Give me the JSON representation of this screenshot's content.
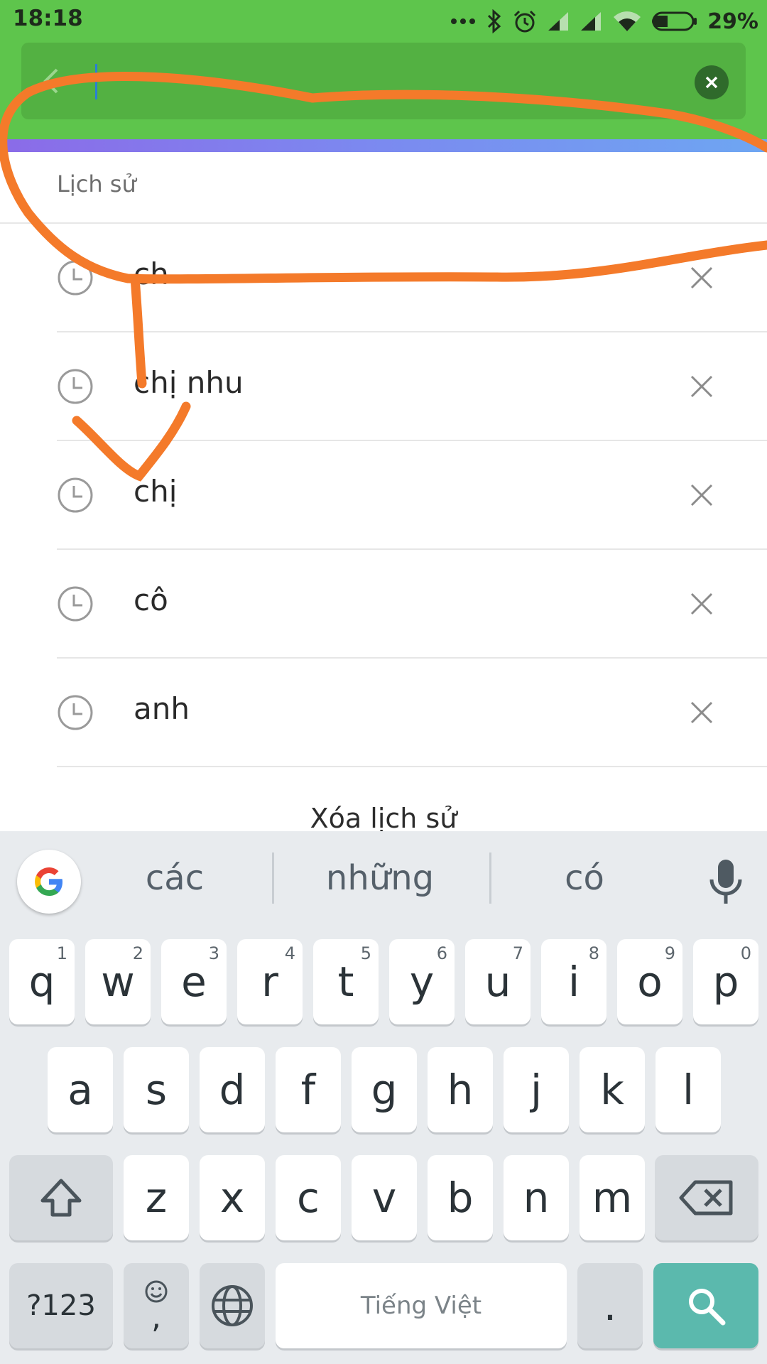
{
  "status_bar": {
    "time": "18:18",
    "battery": "29%"
  },
  "search": {
    "value": "",
    "icons": {
      "back": "back-chevron-icon",
      "clear": "clear-circle-icon"
    }
  },
  "history": {
    "title": "Lịch sử",
    "items": [
      {
        "label": "ch"
      },
      {
        "label": "chị nhu"
      },
      {
        "label": "chị"
      },
      {
        "label": "cô"
      },
      {
        "label": "anh"
      }
    ],
    "clear_label": "Xóa lịch sử"
  },
  "keyboard": {
    "suggestions": [
      "các",
      "những",
      "có"
    ],
    "row1": [
      {
        "key": "q",
        "hint": "1"
      },
      {
        "key": "w",
        "hint": "2"
      },
      {
        "key": "e",
        "hint": "3"
      },
      {
        "key": "r",
        "hint": "4"
      },
      {
        "key": "t",
        "hint": "5"
      },
      {
        "key": "y",
        "hint": "6"
      },
      {
        "key": "u",
        "hint": "7"
      },
      {
        "key": "i",
        "hint": "8"
      },
      {
        "key": "o",
        "hint": "9"
      },
      {
        "key": "p",
        "hint": "0"
      }
    ],
    "row2": [
      "a",
      "s",
      "d",
      "f",
      "g",
      "h",
      "j",
      "k",
      "l"
    ],
    "row3": [
      "z",
      "x",
      "c",
      "v",
      "b",
      "n",
      "m"
    ],
    "symbols_label": "?123",
    "comma_label": ",",
    "space_label": "Tiếng Việt",
    "period_label": "."
  },
  "colors": {
    "header_green": "#5ec54c",
    "search_key": "#5bb9ad",
    "annotation_orange": "#f47a2a"
  }
}
